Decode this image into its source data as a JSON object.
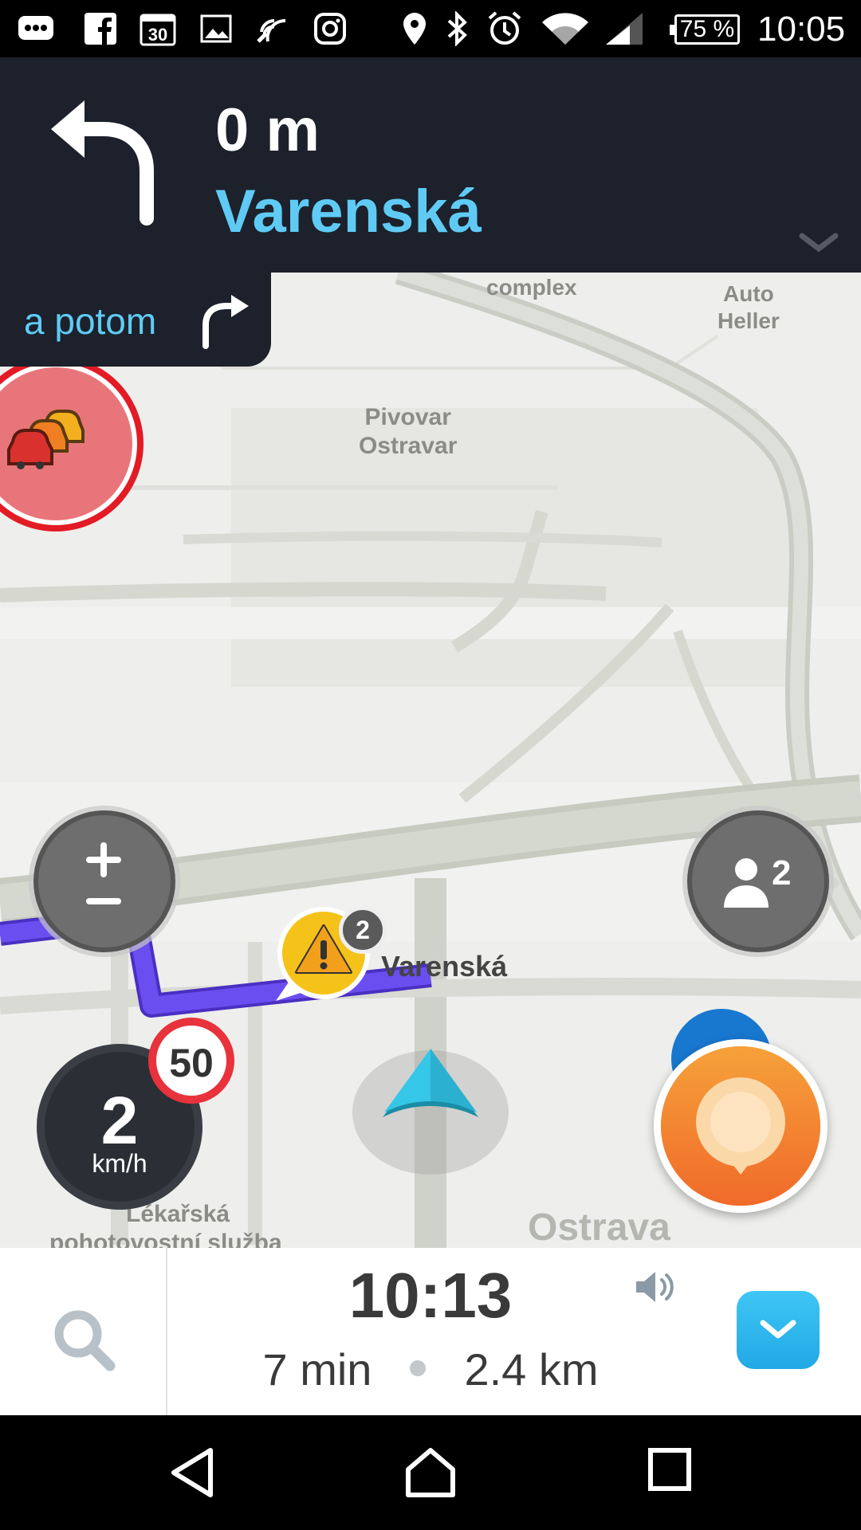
{
  "status_bar": {
    "battery": "75 %",
    "time": "10:05",
    "icons": [
      "chat-icon",
      "facebook-icon",
      "calendar-icon",
      "gallery-icon",
      "nfc-icon",
      "instagram-icon",
      "location-icon",
      "bluetooth-icon",
      "alarm-icon",
      "wifi-icon",
      "signal-icon"
    ],
    "calendar_day": "30"
  },
  "navigation": {
    "distance": "0 m",
    "street": "Varenská",
    "next_label": "a potom",
    "turn": "left-turn-icon",
    "next_turn": "right-turn-icon"
  },
  "map": {
    "labels": {
      "complex": "complex",
      "auto_heller": "Auto\nHeller",
      "pivovar": "Pivovar\nOstravar",
      "lekarska": "Lékařská",
      "pohotovost": "pohotovostní služba",
      "ostrava": "Ostrava"
    },
    "hazard_count": "2",
    "hazard_street": "Varenská",
    "nearby_users": "2",
    "speed": "2",
    "speed_unit": "km/h",
    "speed_limit": "50",
    "colors": {
      "route": "#6b4ef0",
      "arrow": "#35c6e8",
      "report": "#f5852a",
      "traffic_ring": "#e21b24"
    }
  },
  "bottom_bar": {
    "eta": "10:13",
    "duration": "7 min",
    "distance": "2.4 km"
  }
}
